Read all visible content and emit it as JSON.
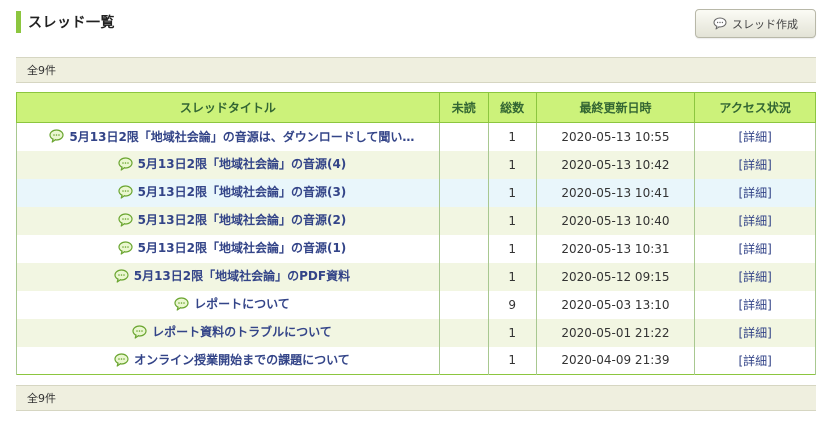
{
  "header": {
    "title": "スレッド一覧",
    "create_button_label": "スレッド作成"
  },
  "summary": {
    "total_label": "全9件"
  },
  "table": {
    "columns": [
      "スレッドタイトル",
      "未読",
      "総数",
      "最終更新日時",
      "アクセス状況"
    ],
    "rows": [
      {
        "title": "5月13日2限「地域社会論」の音源は、ダウンロードして聞い…",
        "unread": "",
        "total": "1",
        "updated": "2020-05-13 10:55",
        "access": "[詳細]"
      },
      {
        "title": "5月13日2限「地域社会論」の音源(4)",
        "unread": "",
        "total": "1",
        "updated": "2020-05-13 10:42",
        "access": "[詳細]"
      },
      {
        "title": "5月13日2限「地域社会論」の音源(3)",
        "unread": "",
        "total": "1",
        "updated": "2020-05-13 10:41",
        "access": "[詳細]"
      },
      {
        "title": "5月13日2限「地域社会論」の音源(2)",
        "unread": "",
        "total": "1",
        "updated": "2020-05-13 10:40",
        "access": "[詳細]"
      },
      {
        "title": "5月13日2限「地域社会論」の音源(1)",
        "unread": "",
        "total": "1",
        "updated": "2020-05-13 10:31",
        "access": "[詳細]"
      },
      {
        "title": "5月13日2限「地域社会論」のPDF資料",
        "unread": "",
        "total": "1",
        "updated": "2020-05-12 09:15",
        "access": "[詳細]"
      },
      {
        "title": "レポートについて",
        "unread": "",
        "total": "9",
        "updated": "2020-05-03 13:10",
        "access": "[詳細]"
      },
      {
        "title": "レポート資料のトラブルについて",
        "unread": "",
        "total": "1",
        "updated": "2020-05-01 21:22",
        "access": "[詳細]"
      },
      {
        "title": "オンライン授業開始までの課題について",
        "unread": "",
        "total": "1",
        "updated": "2020-04-09 21:39",
        "access": "[詳細]"
      }
    ]
  },
  "icons": {
    "thread": "speech-bubble-icon",
    "create": "speech-bubble-icon"
  },
  "colors": {
    "accent": "#8cc63f",
    "header_bg": "#ccf27a",
    "link": "#334488",
    "summary_bg": "#efefdf"
  }
}
